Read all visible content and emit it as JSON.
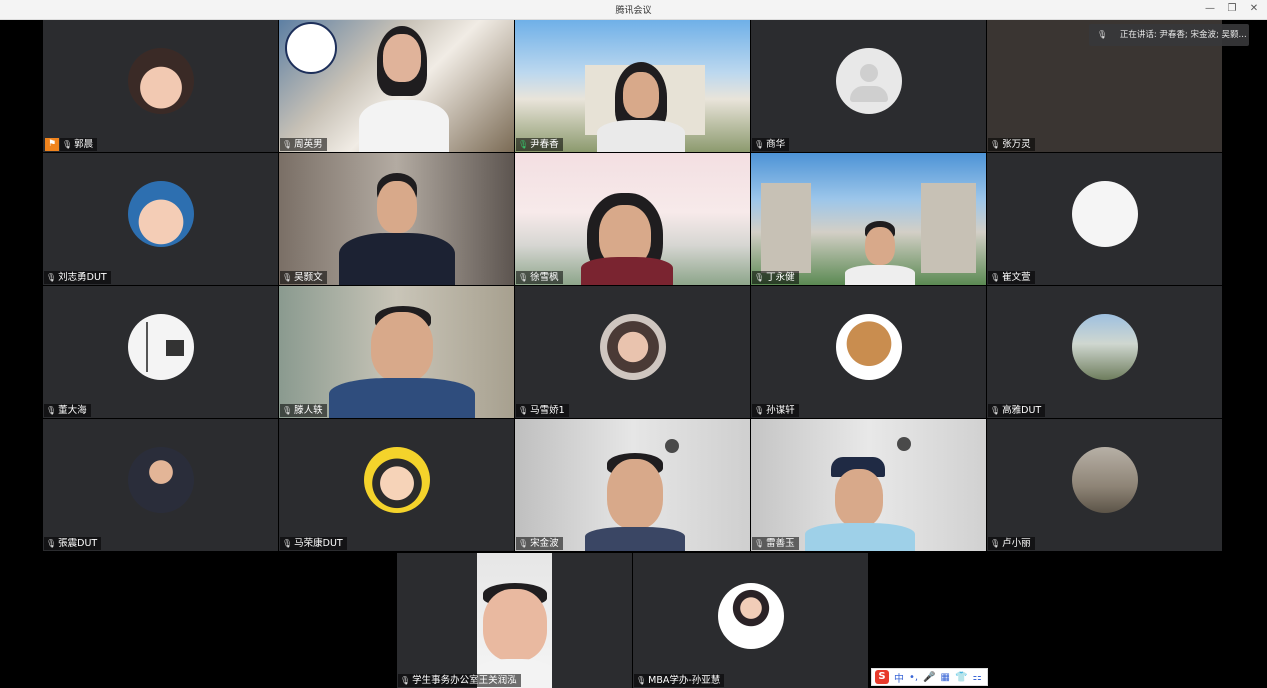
{
  "window": {
    "title": "腾讯会议",
    "minimize_icon": "—",
    "restore_icon": "❐",
    "close_icon": "✕"
  },
  "speaking_indicator": {
    "label": "正在讲话: 尹春香; 宋金波; 吴颢..."
  },
  "participants": [
    {
      "name": "郭晨",
      "host": true
    },
    {
      "name": "周英男"
    },
    {
      "name": "尹春香",
      "active_speaker": true
    },
    {
      "name": "商华"
    },
    {
      "name": "张万灵"
    },
    {
      "name": "刘志勇DUT"
    },
    {
      "name": "吴颢文"
    },
    {
      "name": "徐雪枫"
    },
    {
      "name": "丁永健"
    },
    {
      "name": "崔文萱"
    },
    {
      "name": "董大海"
    },
    {
      "name": "滕人轶"
    },
    {
      "name": "马雪娇1"
    },
    {
      "name": "孙谋轩"
    },
    {
      "name": "高雅DUT"
    },
    {
      "name": "張震DUT"
    },
    {
      "name": "马荣康DUT"
    },
    {
      "name": "宋金波"
    },
    {
      "name": "雷善玉"
    },
    {
      "name": "卢小丽"
    },
    {
      "name": "学生事务办公室王关润泓"
    },
    {
      "name": "MBA学办-孙亚慧"
    }
  ],
  "ime_toolbar": {
    "logo": "S",
    "items": [
      "中",
      "•,",
      "🎤",
      "▦",
      "👕",
      "⚏"
    ]
  },
  "colors": {
    "tile_bg": "#2b2c2f",
    "active_border": "#35c46a",
    "host_badge": "#f0841e"
  }
}
